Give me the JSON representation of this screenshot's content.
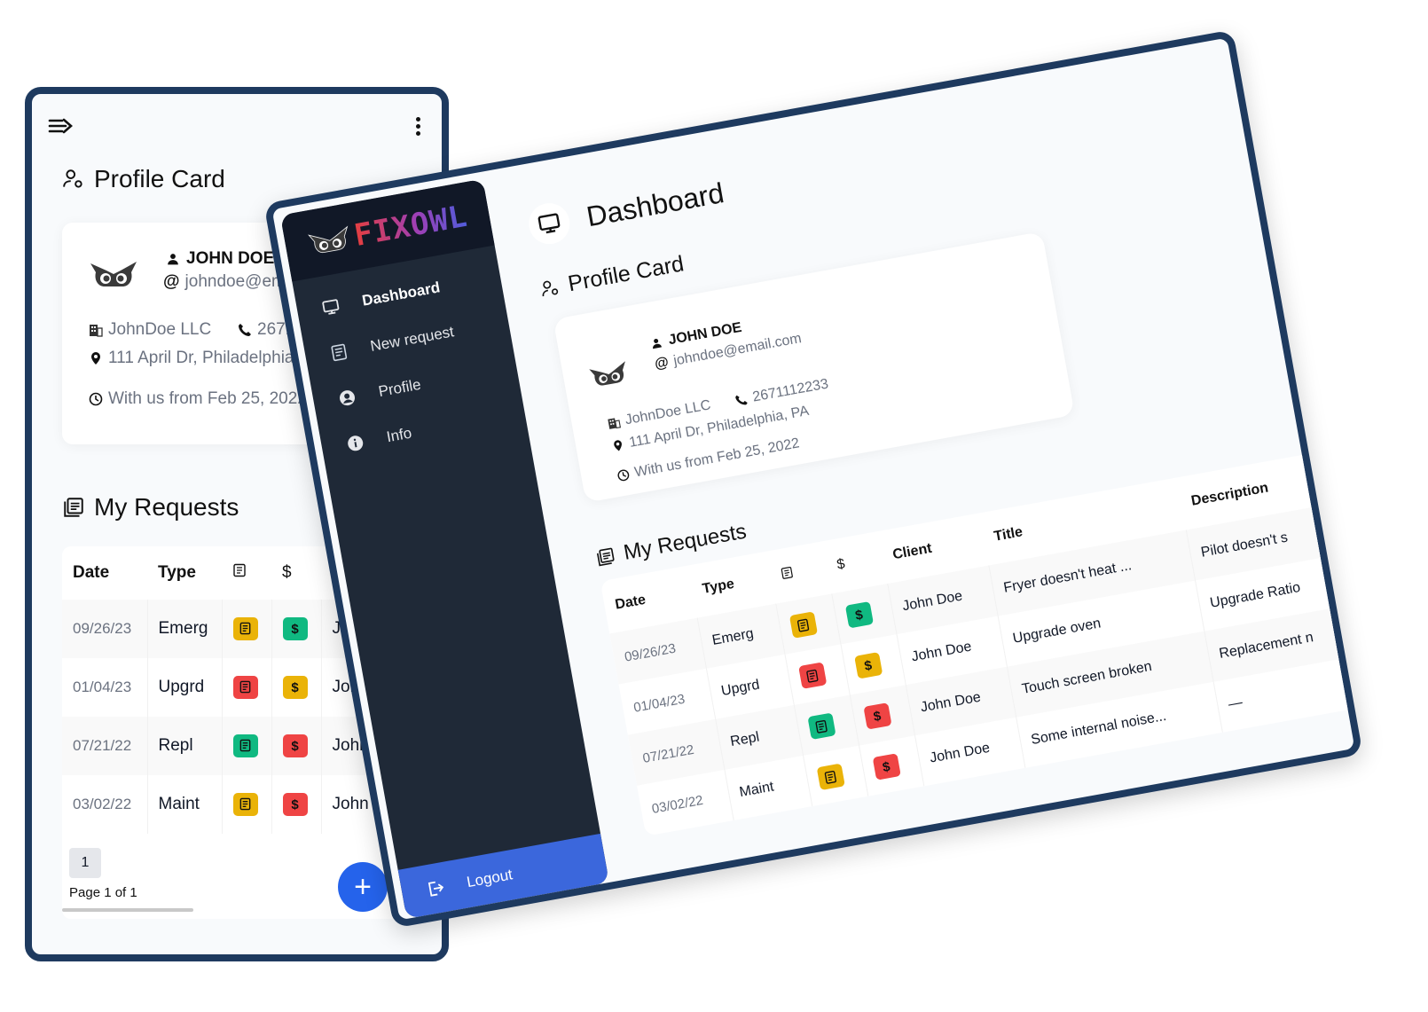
{
  "colors": {
    "frame": "#1e3a5f",
    "sidebar": "#1f2937",
    "accent": "#2563eb",
    "logout_bg": "#3b67dc",
    "badge_yellow": "#eab308",
    "badge_red": "#ef4444",
    "badge_green": "#10b981"
  },
  "brand": {
    "name": "FIXOWL"
  },
  "mobile": {
    "menu_icon": "menu-arrow-icon",
    "more_icon": "kebab-icon",
    "profile_section_title": "Profile Card",
    "requests_section_title": "My Requests",
    "pagination": {
      "current_page": "1",
      "label": "Page 1 of 1"
    },
    "fab_label": "+"
  },
  "desktop": {
    "page_title": "Dashboard",
    "profile_section_title": "Profile Card",
    "requests_section_title": "My Requests",
    "sidebar": {
      "items": [
        {
          "label": "Dashboard",
          "icon": "monitor-icon",
          "active": true
        },
        {
          "label": "New request",
          "icon": "document-icon",
          "active": false
        },
        {
          "label": "Profile",
          "icon": "user-circle-icon",
          "active": false
        },
        {
          "label": "Info",
          "icon": "info-icon",
          "active": false
        }
      ],
      "logout_label": "Logout"
    }
  },
  "profile": {
    "name": "JOHN DOE",
    "email": "johndoe@email.com",
    "company": "JohnDoe LLC",
    "phone": "2671112233",
    "address": "111 April Dr, Philadelphia, PA",
    "member_since": "With us from Feb 25, 2022"
  },
  "requests": {
    "columns": [
      "Date",
      "Type",
      "doc-status",
      "payment-status",
      "Client",
      "Title",
      "Description"
    ],
    "rows": [
      {
        "date": "09/26/23",
        "type": "Emerg",
        "doc_status": "yellow",
        "pay_status": "green",
        "client": "John Doe",
        "title": "Fryer doesn't heat ...",
        "description": "Pilot doesn't s"
      },
      {
        "date": "01/04/23",
        "type": "Upgrd",
        "doc_status": "red",
        "pay_status": "yellow",
        "client": "John Doe",
        "title": "Upgrade oven",
        "description": "Upgrade Ratio"
      },
      {
        "date": "07/21/22",
        "type": "Repl",
        "doc_status": "green",
        "pay_status": "red",
        "client": "John Doe",
        "title": "Touch screen broken",
        "description": "Replacement n"
      },
      {
        "date": "03/02/22",
        "type": "Maint",
        "doc_status": "yellow",
        "pay_status": "red",
        "client": "John Doe",
        "title": "Some internal noise...",
        "description": "—"
      }
    ],
    "pay_symbol": "$"
  }
}
